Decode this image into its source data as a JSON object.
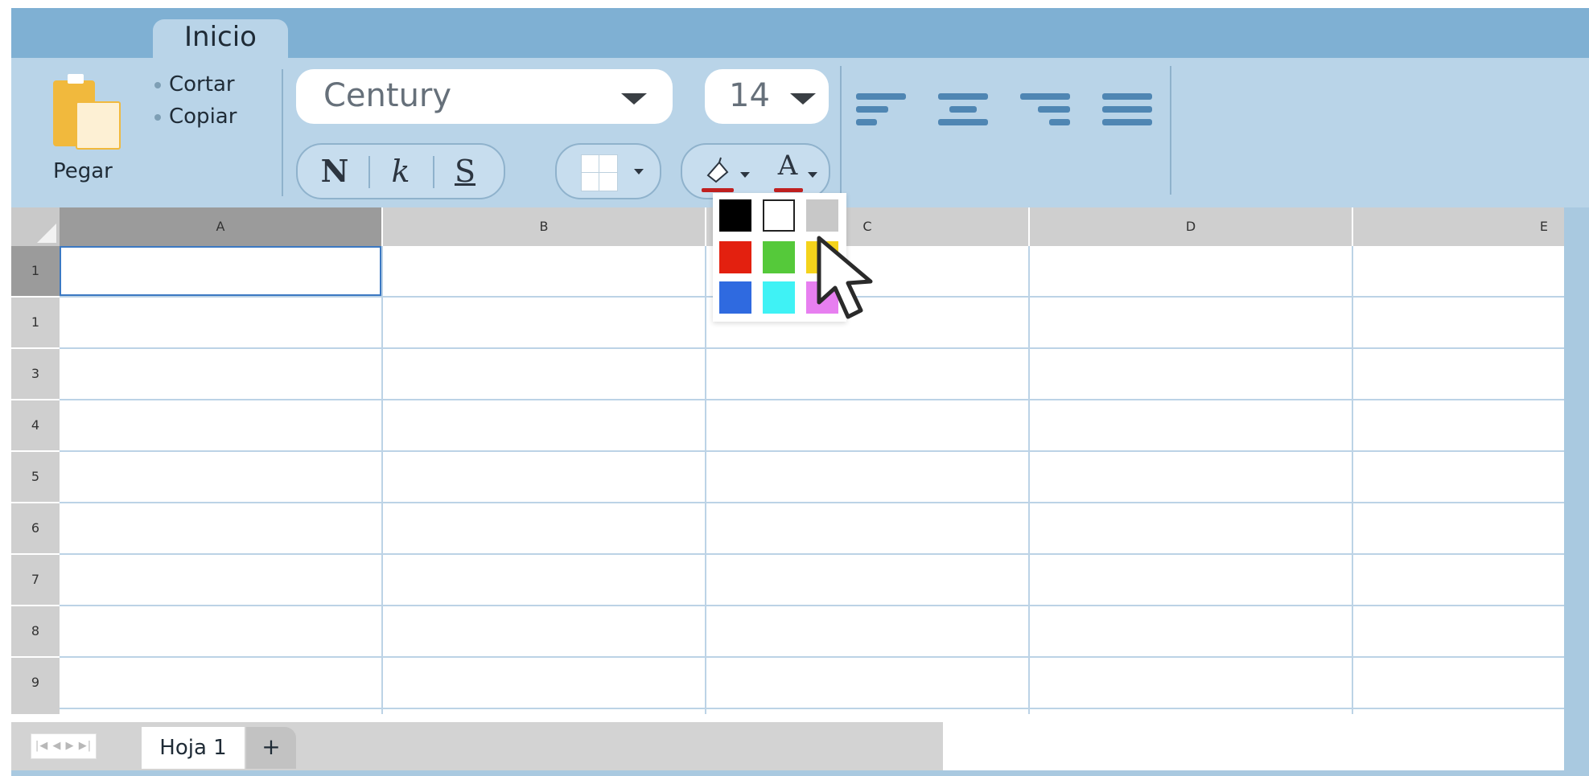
{
  "tabs": {
    "active": "Inicio"
  },
  "clipboard": {
    "paste_label": "Pegar",
    "cut_label": "Cortar",
    "copy_label": "Copiar"
  },
  "font": {
    "family": "Century",
    "size": "14"
  },
  "format": {
    "bold": "N",
    "italic": "k",
    "underline": "S"
  },
  "font_color_glyph": "A",
  "colors": {
    "ribbon": "#b9d4e8",
    "tabstrip": "#7fb0d3",
    "selection": "#3b78c2",
    "palette": [
      "#000000",
      "#ffffff",
      "#c8c8c8",
      "#e3200f",
      "#55c93a",
      "#f4d31b",
      "#2f6ae0",
      "#3ff2f5",
      "#e77ff0"
    ]
  },
  "icons": [
    "paste-icon",
    "fill-color-icon",
    "font-color-icon",
    "borders-icon",
    "align-left-icon",
    "align-center-icon",
    "align-right-icon",
    "justify-icon",
    "mouse-pointer-icon"
  ],
  "sheet": {
    "columns": [
      "A",
      "B",
      "C",
      "D",
      "E"
    ],
    "rows": [
      "1",
      "1",
      "3",
      "4",
      "5",
      "6",
      "7",
      "8",
      "9"
    ],
    "selected_cell": "A1"
  },
  "sheet_tabs": {
    "nav": "|◀ ◀ ▶ ▶|",
    "current": "Hoja 1",
    "add": "+"
  }
}
